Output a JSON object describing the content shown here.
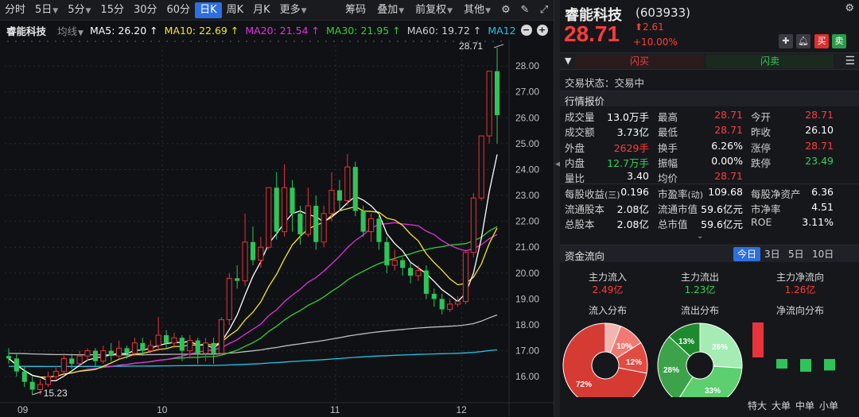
{
  "toolbar": {
    "periods": [
      "分时",
      "5日",
      "5分",
      "15分",
      "30分",
      "60分",
      "日K",
      "周K",
      "月K",
      "更多"
    ],
    "active_period": "日K",
    "right_items": [
      "筹码",
      "叠加",
      "前复权",
      "其他"
    ]
  },
  "ma_bar": {
    "stock": "睿能科技",
    "avg_line": "均线",
    "ma5": "MA5: 26.20 ↑",
    "ma10": "MA10: 22.69 ↑",
    "ma20": "MA20: 21.54 ↑",
    "ma30": "MA30: 21.95 ↑",
    "ma60": "MA60: 19.72 ↑",
    "ma120": "MA12",
    "colors": {
      "ma5": "#ffffff",
      "ma10": "#f5e52a",
      "ma20": "#e030e0",
      "ma30": "#34d034",
      "ma60": "#bdbdbd",
      "ma120": "#1fc6e6"
    }
  },
  "chart_data": {
    "type": "candlestick",
    "y_ticks": [
      "28.00",
      "27.00",
      "26.00",
      "25.00",
      "24.00",
      "23.00",
      "22.00",
      "21.00",
      "20.00",
      "19.00",
      "18.00",
      "17.00",
      "16.00"
    ],
    "ylim": [
      15.3,
      28.8
    ],
    "x_ticks": [
      "09",
      "10",
      "11",
      "12"
    ],
    "high_label": "28.71",
    "low_label": "15.23",
    "candles": [
      [
        16.8,
        16.7,
        17.1,
        16.5
      ],
      [
        16.7,
        16.2,
        16.9,
        16.0
      ],
      [
        16.2,
        15.8,
        16.4,
        15.6
      ],
      [
        15.8,
        15.5,
        16.0,
        15.3
      ],
      [
        15.5,
        15.7,
        15.9,
        15.3
      ],
      [
        15.7,
        16.0,
        16.2,
        15.6
      ],
      [
        16.0,
        16.2,
        16.4,
        15.9
      ],
      [
        16.2,
        16.7,
        16.9,
        16.1
      ],
      [
        16.7,
        16.5,
        16.9,
        16.3
      ],
      [
        16.5,
        16.8,
        17.0,
        16.4
      ],
      [
        16.8,
        17.0,
        17.1,
        16.6
      ],
      [
        17.0,
        16.6,
        17.1,
        16.4
      ],
      [
        16.6,
        17.0,
        17.2,
        16.5
      ],
      [
        17.0,
        16.8,
        17.3,
        16.6
      ],
      [
        16.8,
        17.1,
        17.4,
        16.7
      ],
      [
        17.1,
        16.9,
        17.2,
        16.7
      ],
      [
        16.9,
        17.3,
        17.5,
        16.8
      ],
      [
        17.3,
        17.0,
        17.5,
        16.8
      ],
      [
        17.0,
        17.2,
        17.4,
        16.9
      ],
      [
        17.2,
        17.6,
        18.3,
        17.0
      ],
      [
        17.6,
        17.3,
        17.8,
        17.1
      ],
      [
        17.3,
        17.5,
        17.7,
        17.1
      ],
      [
        17.5,
        17.0,
        17.6,
        16.6
      ],
      [
        17.0,
        17.4,
        17.6,
        16.7
      ],
      [
        17.4,
        16.9,
        17.5,
        16.5
      ],
      [
        16.9,
        17.3,
        17.5,
        16.6
      ],
      [
        17.3,
        16.9,
        17.5,
        16.5
      ],
      [
        16.9,
        18.2,
        18.3,
        16.8
      ],
      [
        18.2,
        19.8,
        20.0,
        18.0
      ],
      [
        19.8,
        19.7,
        20.3,
        19.4
      ],
      [
        19.7,
        21.2,
        22.3,
        19.5
      ],
      [
        21.2,
        20.5,
        21.8,
        20.3
      ],
      [
        20.5,
        21.0,
        21.4,
        20.2
      ],
      [
        21.0,
        23.3,
        23.3,
        20.9
      ],
      [
        23.3,
        21.6,
        23.9,
        21.3
      ],
      [
        21.6,
        23.3,
        24.2,
        21.4
      ],
      [
        23.3,
        22.3,
        23.6,
        21.6
      ],
      [
        22.3,
        21.5,
        22.6,
        21.1
      ],
      [
        21.5,
        22.6,
        23.3,
        21.4
      ],
      [
        22.6,
        21.2,
        23.0,
        20.9
      ],
      [
        21.2,
        22.3,
        22.6,
        21.0
      ],
      [
        22.3,
        23.2,
        23.9,
        22.0
      ],
      [
        23.2,
        22.8,
        23.6,
        22.4
      ],
      [
        22.8,
        24.1,
        24.6,
        22.6
      ],
      [
        24.1,
        22.4,
        24.3,
        22.2
      ],
      [
        22.4,
        21.6,
        22.6,
        21.4
      ],
      [
        21.6,
        22.1,
        22.3,
        21.2
      ],
      [
        22.1,
        21.2,
        22.3,
        20.9
      ],
      [
        21.2,
        20.3,
        21.4,
        20.0
      ],
      [
        20.3,
        20.5,
        20.9,
        20.1
      ],
      [
        20.5,
        20.2,
        20.6,
        19.9
      ],
      [
        20.2,
        19.9,
        20.4,
        19.6
      ],
      [
        19.9,
        20.1,
        20.3,
        19.7
      ],
      [
        20.1,
        19.2,
        20.3,
        19.0
      ],
      [
        19.2,
        19.0,
        19.4,
        18.7
      ],
      [
        19.0,
        18.6,
        19.2,
        18.4
      ],
      [
        18.6,
        18.8,
        19.0,
        18.5
      ],
      [
        18.8,
        18.9,
        19.1,
        18.7
      ],
      [
        18.9,
        20.8,
        20.9,
        18.8
      ],
      [
        20.8,
        22.9,
        23.1,
        20.6
      ],
      [
        22.9,
        25.3,
        25.3,
        22.8
      ],
      [
        25.3,
        27.8,
        27.8,
        25.0
      ],
      [
        27.8,
        26.1,
        28.71,
        25.0
      ]
    ]
  },
  "right": {
    "name": "睿能科技",
    "code": "(603933)",
    "price": "28.71",
    "chg_abs": "⬆2.61",
    "chg_pct": "+10.00%",
    "flash_buy": "闪买",
    "flash_sell": "闪卖",
    "buy_label": "买",
    "sell_label": "卖",
    "trade_status": "交易状态：交易中",
    "quote_title": "行情报价",
    "quote_rows": [
      [
        [
          "成交量",
          "13.0万手",
          "w"
        ],
        [
          "最高",
          "28.71",
          "r"
        ],
        [
          "今开",
          "28.71",
          "r"
        ]
      ],
      [
        [
          "成交额",
          "3.73亿",
          "w"
        ],
        [
          "最低",
          "28.71",
          "r"
        ],
        [
          "昨收",
          "26.10",
          "w"
        ]
      ],
      [
        [
          "外盘",
          "2629手",
          "r"
        ],
        [
          "换手",
          "6.26%",
          "w"
        ],
        [
          "涨停",
          "28.71",
          "r"
        ]
      ],
      [
        [
          "内盘",
          "12.7万手",
          "g"
        ],
        [
          "振幅",
          "0.00%",
          "w"
        ],
        [
          "跌停",
          "23.49",
          "g"
        ]
      ],
      [
        [
          "量比",
          "3.40",
          "w"
        ],
        [
          "均价",
          "28.71",
          "r"
        ],
        [
          "",
          "",
          "w"
        ]
      ],
      [
        [
          "每股收益",
          "0.196",
          "w"
        ],
        [
          "市盈率",
          "109.68",
          "w"
        ],
        [
          "每股净资产",
          "6.36",
          "w"
        ]
      ],
      [
        [
          "流通股本",
          "2.08亿",
          "w"
        ],
        [
          "流通市值",
          "59.6亿元",
          "w"
        ],
        [
          "市净率",
          "4.51",
          "w"
        ]
      ],
      [
        [
          "总股本",
          "2.08亿",
          "w"
        ],
        [
          "总市值",
          "59.6亿元",
          "w"
        ],
        [
          "ROE",
          "3.11%",
          "w"
        ]
      ]
    ],
    "eps_suffix": "(三)",
    "pe_suffix": "(动)",
    "fund_title": "资金流向",
    "day_tabs": [
      "今日",
      "3日",
      "5日",
      "10日"
    ],
    "active_tab": "今日",
    "flow": {
      "in_label": "主力流入",
      "in_val": "2.49亿",
      "out_label": "主力流出",
      "out_val": "1.23亿",
      "net_label": "主力净流向",
      "net_val": "1.26亿"
    },
    "dist_titles": [
      "流入分布",
      "流出分布",
      "净流向分布"
    ],
    "pie_in": {
      "labels": [
        "72%",
        "10%",
        "12%"
      ],
      "values": [
        72,
        10,
        12,
        6
      ]
    },
    "pie_out": {
      "labels": [
        "26%",
        "33%",
        "28%",
        "13%"
      ],
      "values": [
        26,
        33,
        28,
        13
      ]
    },
    "net_bars": {
      "categories": [
        "特大",
        "大单",
        "中单",
        "小单"
      ],
      "values": [
        0.55,
        -0.15,
        -0.2,
        -0.18
      ]
    }
  }
}
